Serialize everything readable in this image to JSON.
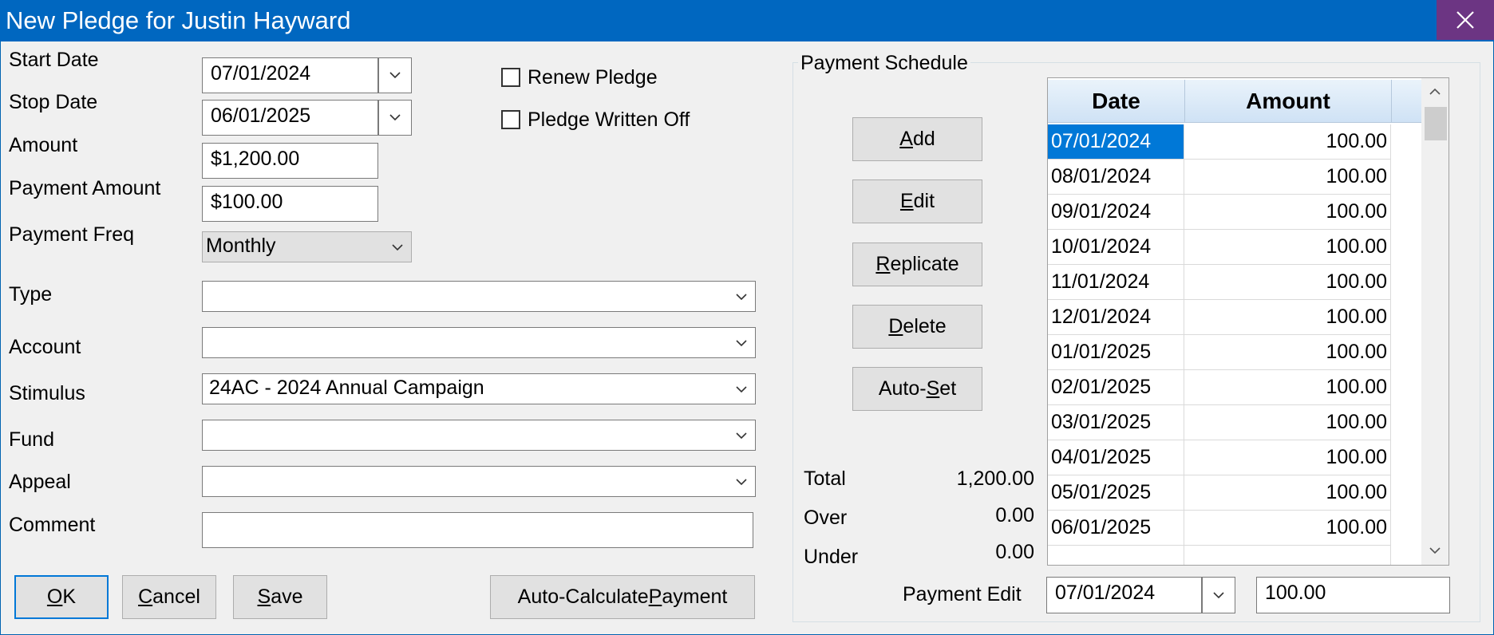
{
  "window": {
    "title": "New Pledge for Justin Hayward"
  },
  "form": {
    "start_date_label": "Start Date",
    "start_date_value": "07/01/2024",
    "stop_date_label": "Stop Date",
    "stop_date_value": "06/01/2025",
    "amount_label": "Amount",
    "amount_value": "$1,200.00",
    "payment_amount_label": "Payment Amount",
    "payment_amount_value": "$100.00",
    "payment_freq_label": "Payment Freq",
    "payment_freq_value": "Monthly",
    "type_label": "Type",
    "type_value": "",
    "account_label": "Account",
    "account_value": "",
    "stimulus_label": "Stimulus",
    "stimulus_value": "24AC - 2024 Annual Campaign",
    "fund_label": "Fund",
    "fund_value": "",
    "appeal_label": "Appeal",
    "appeal_value": "",
    "comment_label": "Comment",
    "comment_value": "",
    "renew_pledge_label": "Renew Pledge",
    "renew_pledge_checked": false,
    "written_off_label": "Pledge Written Off",
    "written_off_checked": false
  },
  "buttons": {
    "ok": {
      "mn": "O",
      "rest": "K"
    },
    "cancel": {
      "mn": "C",
      "rest": "ancel"
    },
    "save": {
      "mn": "S",
      "rest": "ave"
    },
    "autocalc": {
      "pre": "Auto-Calculate ",
      "mn": "P",
      "post": "ayment"
    }
  },
  "schedule": {
    "group_label": "Payment Schedule",
    "buttons": {
      "add": {
        "mn": "A",
        "rest": "dd"
      },
      "edit": {
        "mn": "E",
        "rest": "dit"
      },
      "replicate": {
        "mn": "R",
        "rest": "eplicate"
      },
      "delete": {
        "mn": "D",
        "rest": "elete"
      },
      "autoset": {
        "pre": "Auto-",
        "mn": "S",
        "post": "et"
      }
    },
    "columns": [
      "Date",
      "Amount"
    ],
    "rows": [
      {
        "date": "07/01/2024",
        "amount": "100.00",
        "selected": true
      },
      {
        "date": "08/01/2024",
        "amount": "100.00"
      },
      {
        "date": "09/01/2024",
        "amount": "100.00"
      },
      {
        "date": "10/01/2024",
        "amount": "100.00"
      },
      {
        "date": "11/01/2024",
        "amount": "100.00"
      },
      {
        "date": "12/01/2024",
        "amount": "100.00"
      },
      {
        "date": "01/01/2025",
        "amount": "100.00"
      },
      {
        "date": "02/01/2025",
        "amount": "100.00"
      },
      {
        "date": "03/01/2025",
        "amount": "100.00"
      },
      {
        "date": "04/01/2025",
        "amount": "100.00"
      },
      {
        "date": "05/01/2025",
        "amount": "100.00"
      },
      {
        "date": "06/01/2025",
        "amount": "100.00"
      }
    ],
    "total_label": "Total",
    "total_value": "1,200.00",
    "over_label": "Over",
    "over_value": "0.00",
    "under_label": "Under",
    "under_value": "0.00",
    "payment_edit_label": "Payment Edit",
    "payment_edit_date": "07/01/2024",
    "payment_edit_amount": "100.00"
  },
  "icons": {
    "close": "close-icon",
    "dropdown": "chevron-down-icon",
    "scroll_up": "scroll-up-arrow-icon",
    "scroll_down": "scroll-down-arrow-icon"
  },
  "colors": {
    "titlebar": "#0067c0",
    "close_button": "#6c3583",
    "selection": "#0078d7",
    "window_bg": "#f0f0f0"
  }
}
